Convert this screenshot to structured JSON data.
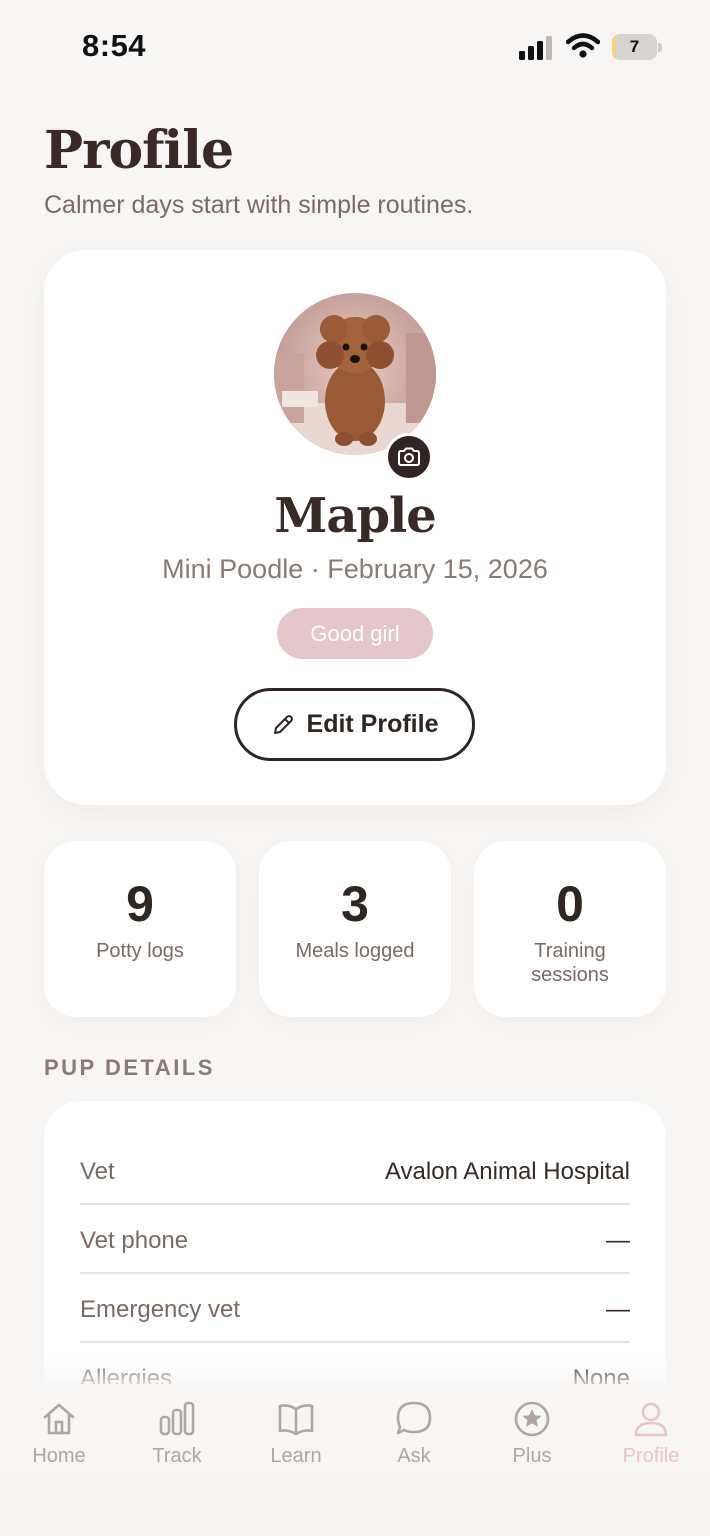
{
  "status_bar": {
    "time": "8:54",
    "battery_level": "7",
    "battery_fraction": 0.07
  },
  "header": {
    "title": "Profile",
    "subtitle": "Calmer days start with simple routines."
  },
  "profile": {
    "name": "Maple",
    "meta": "Mini Poodle · February 15, 2026",
    "badge": "Good girl",
    "edit_label": "Edit Profile",
    "avatar_icon": "poodle-photo",
    "camera_icon": "camera-icon"
  },
  "stats": [
    {
      "value": "9",
      "label": "Potty logs"
    },
    {
      "value": "3",
      "label": "Meals logged"
    },
    {
      "value": "0",
      "label": "Training sessions"
    }
  ],
  "details": {
    "heading": "PUP DETAILS",
    "rows": [
      {
        "label": "Vet",
        "value": "Avalon Animal Hospital"
      },
      {
        "label": "Vet phone",
        "value": "—"
      },
      {
        "label": "Emergency vet",
        "value": "—"
      },
      {
        "label": "Allergies",
        "value": "None"
      }
    ]
  },
  "tabs": [
    {
      "label": "Home",
      "icon": "home-icon"
    },
    {
      "label": "Track",
      "icon": "bar-chart-icon"
    },
    {
      "label": "Learn",
      "icon": "book-icon"
    },
    {
      "label": "Ask",
      "icon": "chat-bubble-icon"
    },
    {
      "label": "Plus",
      "icon": "star-circle-icon"
    },
    {
      "label": "Profile",
      "icon": "person-icon",
      "active": true
    }
  ],
  "colors": {
    "background": "#f8f6f4",
    "text_dark": "#3a2a27",
    "text_muted": "#7a6a66",
    "badge_pink": "#e4c6cb",
    "active_tab": "#e8c4cb"
  }
}
